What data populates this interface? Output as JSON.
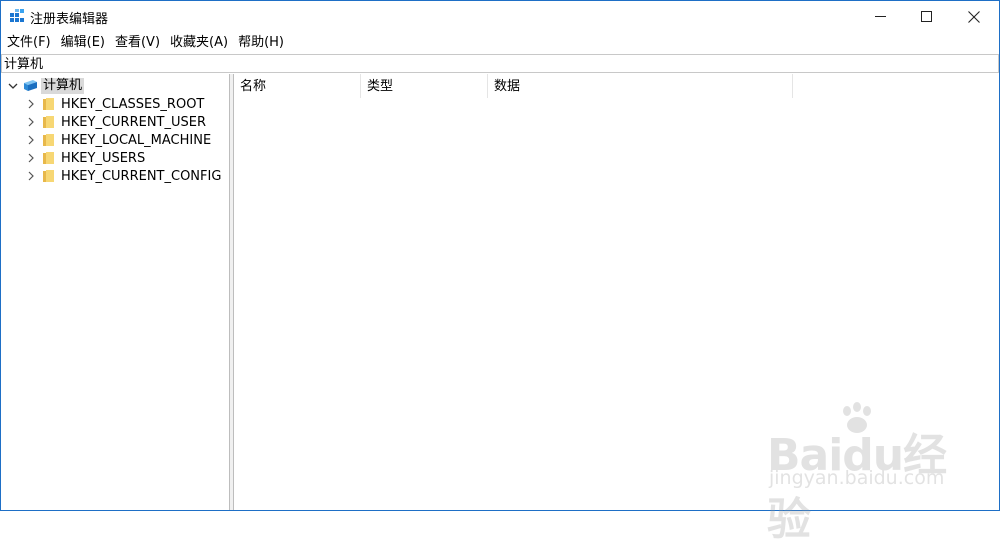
{
  "window": {
    "title": "注册表编辑器",
    "accent_color": "#1e6fc6"
  },
  "menu": [
    {
      "label": "文件(F)"
    },
    {
      "label": "编辑(E)"
    },
    {
      "label": "查看(V)"
    },
    {
      "label": "收藏夹(A)"
    },
    {
      "label": "帮助(H)"
    }
  ],
  "address": {
    "path": "计算机"
  },
  "tree": {
    "root": {
      "label": "计算机",
      "icon": "computer-icon",
      "expanded": true,
      "selected": true
    },
    "children": [
      {
        "label": "HKEY_CLASSES_ROOT",
        "icon": "folder-icon"
      },
      {
        "label": "HKEY_CURRENT_USER",
        "icon": "folder-icon"
      },
      {
        "label": "HKEY_LOCAL_MACHINE",
        "icon": "folder-icon"
      },
      {
        "label": "HKEY_USERS",
        "icon": "folder-icon"
      },
      {
        "label": "HKEY_CURRENT_CONFIG",
        "icon": "folder-icon"
      }
    ]
  },
  "list": {
    "columns": [
      "名称",
      "类型",
      "数据"
    ]
  },
  "watermark": {
    "brand": "Baidu经验",
    "url": "jingyan.baidu.com"
  }
}
